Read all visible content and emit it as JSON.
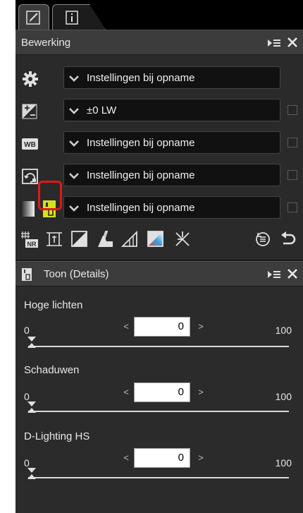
{
  "tabs": [
    {
      "name": "edit",
      "icon": "edit-pencil-icon",
      "active": true
    },
    {
      "name": "info",
      "icon": "info-icon",
      "active": false
    }
  ],
  "edit_panel": {
    "title": "Bewerking",
    "rows": [
      {
        "icon": "gear-icon",
        "value": "Instellingen bij opname",
        "has_checkbox": false
      },
      {
        "icon": "exposure-compensation-icon",
        "value": "±0 LW",
        "has_checkbox": true
      },
      {
        "icon": "white-balance-icon",
        "value": "Instellingen bij opname",
        "has_checkbox": true
      },
      {
        "icon": "picture-control-icon",
        "value": "Instellingen bij opname",
        "has_checkbox": true
      },
      {
        "icon": "tone-details-icon",
        "value": "Instellingen bij opname",
        "has_checkbox": true
      }
    ],
    "highlight_color": "#e01919"
  },
  "toolbar": {
    "tools": [
      "noise-reduction-icon",
      "crop-straighten-icon",
      "levels-curves-icon",
      "color-booster-icon",
      "perspective-icon",
      "lch-icon",
      "retouch-brush-icon"
    ],
    "right_tools": [
      "history-icon",
      "undo-icon"
    ]
  },
  "toon_panel": {
    "title": "Toon (Details)",
    "sliders": [
      {
        "label": "Hoge lichten",
        "min": "0",
        "max": "100",
        "value": "0",
        "level": 0
      },
      {
        "label": "Schaduwen",
        "min": "0",
        "max": "100",
        "value": "0",
        "level": 0
      },
      {
        "label": "D-Lighting HS",
        "min": "0",
        "max": "100",
        "value": "0",
        "level": 0
      }
    ]
  },
  "colors": {
    "panel_bg": "#2b2b2b",
    "header_bg": "#3c3c3c",
    "dropdown_bg": "#111111",
    "accent_yellow": "#d4e21a"
  }
}
